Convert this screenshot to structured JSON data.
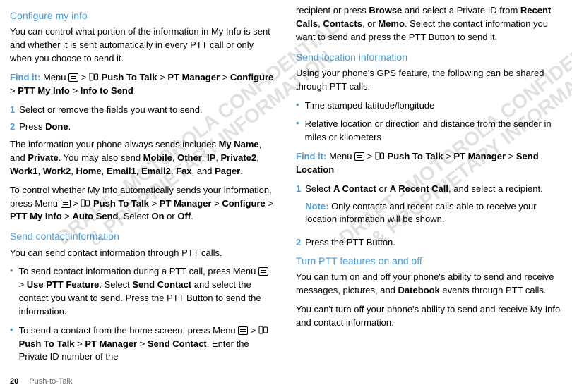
{
  "left": {
    "h_configure": "Configure my info",
    "p1": "You can control what portion of the information in My Info is sent and whether it is sent automatically in every PTT call or only when you choose to send it.",
    "findit_label": "Find it:",
    "findit_prefix": "Menu ",
    "findit_sep1": " > ",
    "findit_ptt": " Push To Talk",
    "findit_sep2": " > ",
    "findit_pm": "PT Manager",
    "findit_sep3": " > ",
    "findit_conf": "Configure",
    "findit_sep4": " > ",
    "findit_pmi": "PTT My Info",
    "findit_sep5": " > ",
    "findit_its": "Info to Send",
    "step1": "Select or remove the fields you want to send.",
    "step2_a": "Press ",
    "step2_b": "Done",
    "step2_c": ".",
    "p2a": "The information your phone always sends includes ",
    "p2b": "My Name",
    "p2c": ", and ",
    "p2d": "Private",
    "p2e": ". You may also send ",
    "p2f": "Mobile",
    "p2g": ", ",
    "p2h": "Other",
    "p2i": ", ",
    "p2j": "IP",
    "p2k": ", ",
    "p2l": "Private2",
    "p2m": ", ",
    "p2n": "Work1",
    "p2o": ", ",
    "p2p": "Work2",
    "p2q": ", ",
    "p2r": "Home",
    "p2s": ", ",
    "p2t": "Email1",
    "p2u": ", ",
    "p2v": "Email2",
    "p2w": ", ",
    "p2x": "Fax",
    "p2y": ", and ",
    "p2z": "Pager",
    "p2end": ".",
    "p3a": "To control whether My Info automatically sends your information, press Menu ",
    "p3b": " > ",
    "p3c": " Push To Talk",
    "p3d": " > ",
    "p3e": "PT Manager",
    "p3f": " > ",
    "p3g": "Configure",
    "p3h": " > ",
    "p3i": "PTT My Info",
    "p3j": " > ",
    "p3k": "Auto Send",
    "p3l": ". Select ",
    "p3m": "On",
    "p3n": " or ",
    "p3o": "Off",
    "p3p": ".",
    "h_send": "Send contact information",
    "p4": "You can send contact information through PTT calls.",
    "b1a": "To send contact information during a PTT call, press Menu ",
    "b1b": " > ",
    "b1c": "Use PTT Feature",
    "b1d": ". Select ",
    "b1e": "Send Contact",
    "b1f": " and select the contact you want to send. Press the PTT Button to send the information.",
    "b2a": "To send a contact from the home screen, press Menu ",
    "b2b": " > ",
    "b2c": " Push To Talk",
    "b2d": " > ",
    "b2e": "PT Manager",
    "b2f": " > ",
    "b2g": "Send Contact",
    "b2h": ". Enter the Private ID number of the "
  },
  "right": {
    "cont_a": "recipient or press ",
    "cont_b": "Browse",
    "cont_c": " and select a Private ID from ",
    "cont_d": "Recent Calls",
    "cont_e": ", ",
    "cont_f": "Contacts",
    "cont_g": ", or ",
    "cont_h": "Memo",
    "cont_i": ". Select the contact information you want to send and press the PTT Button to send it.",
    "h_loc": "Send location information",
    "p5": "Using your phone's GPS feature, the following can be shared through PTT calls:",
    "bl1": "Time stamped latitude/longitude",
    "bl2": "Relative location or direction and distance from the sender in miles or kilometers",
    "findit2_label": "Find it:",
    "f2_prefix": "Menu ",
    "f2_s1": " > ",
    "f2_ptt": " Push To Talk",
    "f2_s2": " > ",
    "f2_pm": "PT Manager",
    "f2_s3": " > ",
    "f2_sl": "Send Location",
    "s1a": "Select ",
    "s1b": "A Contact",
    "s1c": " or ",
    "s1d": "A Recent Call",
    "s1e": ", and select a recipient.",
    "note_label": "Note:",
    "note_body": " Only contacts and recent calls able to receive your location information will be shown.",
    "s2": "Press the PTT Button.",
    "h_turn": "Turn PTT features on and off",
    "p6a": "You can turn on and off your phone's ability to send and receive messages, pictures, and ",
    "p6b": "Datebook",
    "p6c": " events through PTT calls.",
    "p7": "You can't turn off your phone's ability to send and receive My Info and contact information."
  },
  "nums": {
    "n1": "1",
    "n2": "2"
  },
  "footer": {
    "page": "20",
    "section": "Push-to-Talk"
  },
  "watermark": "DRAFT - MOTOROLA CONFIDENTIAL\n& PROPRIETARY INFORMATION"
}
